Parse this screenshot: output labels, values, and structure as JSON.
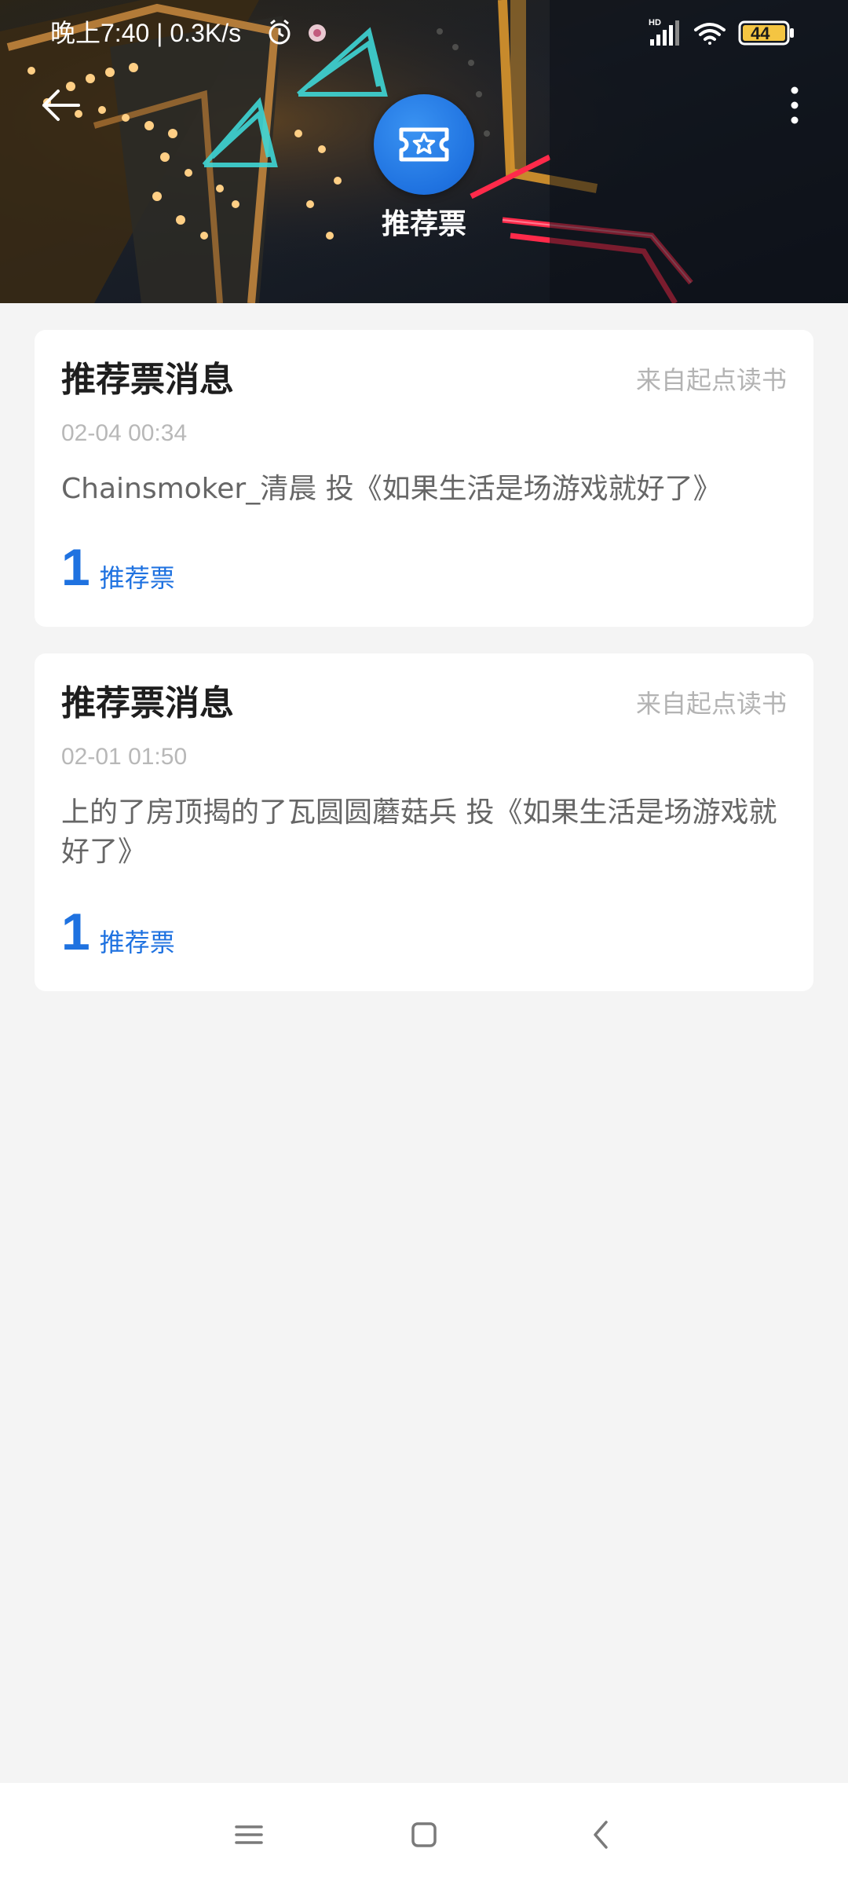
{
  "status_bar": {
    "time": "晚上7:40 | 0.3K/s",
    "battery": "44"
  },
  "header": {
    "title": "推荐票"
  },
  "messages": [
    {
      "title": "推荐票消息",
      "source": "来自起点读书",
      "time": "02-04 00:34",
      "body": "Chainsmoker_清晨 投《如果生活是场游戏就好了》",
      "count": "1",
      "unit": "推荐票"
    },
    {
      "title": "推荐票消息",
      "source": "来自起点读书",
      "time": "02-01 01:50",
      "body": "上的了房顶揭的了瓦圆圆蘑菇兵 投《如果生活是场游戏就好了》",
      "count": "1",
      "unit": "推荐票"
    }
  ],
  "colors": {
    "accent": "#1f72e0",
    "background": "#f4f4f4",
    "card": "#ffffff",
    "muted_text": "#b3b3b3"
  },
  "icons": {
    "back": "arrow-left-icon",
    "more": "more-vertical-icon",
    "badge": "ticket-star-icon",
    "nav_menu": "menu-icon",
    "nav_home": "home-square-icon",
    "nav_back": "chevron-left-icon"
  }
}
